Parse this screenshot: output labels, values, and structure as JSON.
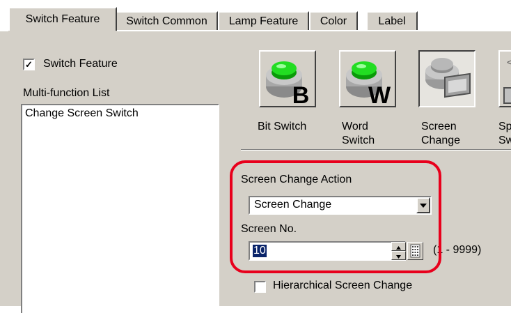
{
  "tabs": [
    {
      "label": "Switch Feature",
      "active": true
    },
    {
      "label": "Switch Common",
      "active": false
    },
    {
      "label": "Lamp Feature",
      "active": false
    },
    {
      "label": "Color",
      "active": false
    },
    {
      "label": "Label",
      "active": false
    }
  ],
  "switch_feature": {
    "label": "Switch Feature",
    "checked": true
  },
  "multi_function": {
    "heading": "Multi-function List",
    "items": [
      "Change Screen Switch"
    ]
  },
  "toolbox": [
    {
      "label": "Bit Switch",
      "letter": "B",
      "icon": "green-button-b-icon"
    },
    {
      "label": "Word\nSwitch",
      "letter": "W",
      "icon": "green-button-w-icon"
    },
    {
      "label": "Screen\nChange",
      "icon": "screen-change-icon",
      "selected": true
    },
    {
      "label": "Sp\nSw",
      "icon": "special-switch-icon"
    }
  ],
  "screen_change_action": {
    "label": "Screen Change Action",
    "value": "Screen Change"
  },
  "screen_no": {
    "label": "Screen No.",
    "value": "10",
    "range": "(1 - 9999)"
  },
  "hierarchical": {
    "label": "Hierarchical Screen Change",
    "checked": false
  },
  "colors": {
    "highlight": "#e8001c",
    "face": "#d4d0c8",
    "button_green": "#22cc22"
  }
}
